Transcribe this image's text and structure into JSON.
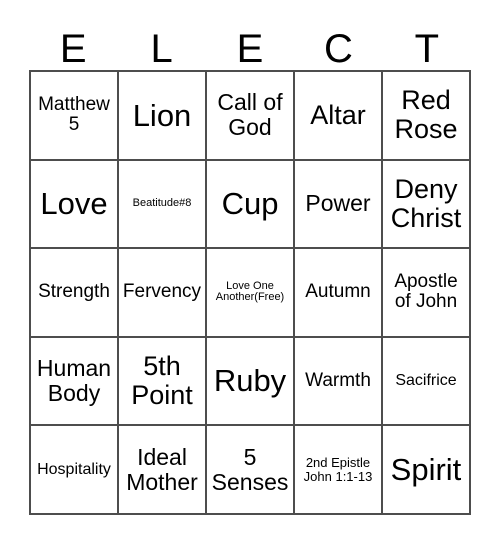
{
  "card": {
    "header_letters": [
      "E",
      "L",
      "E",
      "C",
      "T"
    ],
    "rows": [
      [
        {
          "text": "Matthew 5",
          "size": "fs-m"
        },
        {
          "text": "Lion",
          "size": "fs-xxl"
        },
        {
          "text": "Call of God",
          "size": "fs-l"
        },
        {
          "text": "Altar",
          "size": "fs-xl"
        },
        {
          "text": "Red Rose",
          "size": "fs-xl"
        }
      ],
      [
        {
          "text": "Love",
          "size": "fs-xxl"
        },
        {
          "text": "Beatitude#8",
          "size": "fs-xxs"
        },
        {
          "text": "Cup",
          "size": "fs-xxl"
        },
        {
          "text": "Power",
          "size": "fs-l"
        },
        {
          "text": "Deny Christ",
          "size": "fs-xl"
        }
      ],
      [
        {
          "text": "Strength",
          "size": "fs-m"
        },
        {
          "text": "Fervency",
          "size": "fs-m"
        },
        {
          "text": "Love One Another(Free)",
          "size": "fs-xxs"
        },
        {
          "text": "Autumn",
          "size": "fs-m"
        },
        {
          "text": "Apostle of John",
          "size": "fs-m"
        }
      ],
      [
        {
          "text": "Human Body",
          "size": "fs-l"
        },
        {
          "text": "5th Point",
          "size": "fs-xl"
        },
        {
          "text": "Ruby",
          "size": "fs-xxl"
        },
        {
          "text": "Warmth",
          "size": "fs-m"
        },
        {
          "text": "Sacifrice",
          "size": "fs-s"
        }
      ],
      [
        {
          "text": "Hospitality",
          "size": "fs-s"
        },
        {
          "text": "Ideal Mother",
          "size": "fs-l"
        },
        {
          "text": "5 Senses",
          "size": "fs-l"
        },
        {
          "text": "2nd Epistle John 1:1-13",
          "size": "fs-xs"
        },
        {
          "text": "Spirit",
          "size": "fs-xxl"
        }
      ]
    ],
    "colors": {
      "background": "#ffffff",
      "text": "#000000",
      "border": "#4d4d4d"
    }
  }
}
